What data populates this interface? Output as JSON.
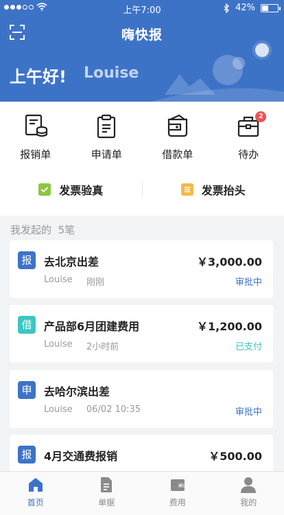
{
  "status_bar": {
    "time": "上午7:00",
    "battery": "42%",
    "battery_level": 0.42
  },
  "header": {
    "title": "嗨快报",
    "greeting": "上午好!",
    "user": "Louise"
  },
  "quick_actions": [
    {
      "label": "报销单",
      "icon": "expense-report-icon"
    },
    {
      "label": "申请单",
      "icon": "clipboard-icon"
    },
    {
      "label": "借款单",
      "icon": "wallet-icon"
    },
    {
      "label": "待办",
      "icon": "briefcase-icon",
      "badge": "2"
    }
  ],
  "invoice_tools": [
    {
      "label": "发票验真",
      "icon": "check-icon",
      "color": "#8cc63f"
    },
    {
      "label": "发票抬头",
      "icon": "header-icon",
      "color": "#f5b94a"
    }
  ],
  "section": {
    "title": "我发起的",
    "count": "5笔"
  },
  "records": [
    {
      "type": "报",
      "type_color": "#3d73c7",
      "title": "去北京出差",
      "amount": "￥3,000.00",
      "applicant": "Louise",
      "time": "刚刚",
      "status": "审批中",
      "status_color": "#3d73c7"
    },
    {
      "type": "借",
      "type_color": "#3cc6c0",
      "title": "产品部6月团建费用",
      "amount": "￥1,200.00",
      "applicant": "Louise",
      "time": "2小时前",
      "status": "已支付",
      "status_color": "#3cc6c0"
    },
    {
      "type": "申",
      "type_color": "#3d73c7",
      "title": "去哈尔滨出差",
      "amount": "",
      "applicant": "Louise",
      "time": "06/02 10:35",
      "status": "审批中",
      "status_color": "#3d73c7"
    },
    {
      "type": "报",
      "type_color": "#3d73c7",
      "title": "4月交通费报销",
      "amount": "￥500.00",
      "applicant": "",
      "time": "",
      "status": "",
      "status_color": "#3d73c7"
    }
  ],
  "tabs": [
    {
      "label": "首页",
      "icon": "home-icon",
      "active": true
    },
    {
      "label": "单据",
      "icon": "document-icon",
      "active": false
    },
    {
      "label": "费用",
      "icon": "wallet-icon",
      "active": false
    },
    {
      "label": "我的",
      "icon": "person-icon",
      "active": false
    }
  ],
  "colors": {
    "primary": "#3d73c7",
    "teal": "#3cc6c0",
    "badge": "#f05252"
  }
}
